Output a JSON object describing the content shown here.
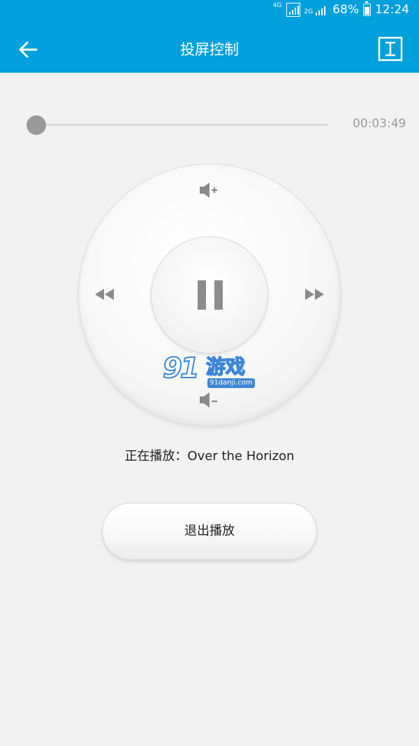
{
  "status_bar": {
    "network_top": "4G",
    "network_bottom": "2G",
    "battery": "68%",
    "time": "12:24"
  },
  "header": {
    "title": "投屏控制",
    "back_icon": "arrow-left-icon",
    "action_icon": "cast-screen-icon",
    "background_color": "#00a0dc"
  },
  "player": {
    "progress": 0.0,
    "duration": "00:03:49",
    "now_playing": "正在播放：Over the Horizon"
  },
  "dial": {
    "center_icon": "pause-icon",
    "top_icon": "volume-up-icon",
    "bottom_icon": "volume-down-icon",
    "left_icon": "rewind-icon",
    "right_icon": "fast-forward-icon"
  },
  "watermark": {
    "number": "91",
    "name": "游戏",
    "url": "91danji.com"
  },
  "exit_button": {
    "label": "退出播放"
  }
}
